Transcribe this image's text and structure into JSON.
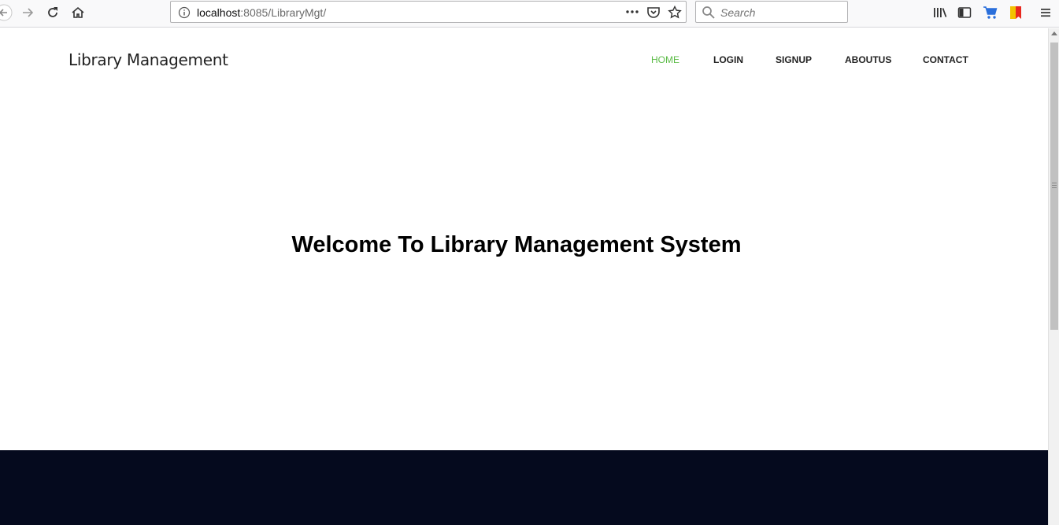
{
  "browser": {
    "url_host": "localhost",
    "url_rest": ":8085/LibraryMgt/",
    "search_placeholder": "Search"
  },
  "site": {
    "brand": "Library Management",
    "nav": [
      {
        "label": "HOME",
        "active": true
      },
      {
        "label": "LOGIN",
        "active": false
      },
      {
        "label": "SIGNUP",
        "active": false
      },
      {
        "label": "ABOUTUS",
        "active": false
      },
      {
        "label": "CONTACT",
        "active": false
      }
    ],
    "welcome": "Welcome To Library Management System"
  },
  "colors": {
    "nav_active": "#5bbb46",
    "footer_bg": "#050a1e"
  },
  "icons": [
    "back-icon",
    "forward-icon",
    "reload-icon",
    "home-icon",
    "info-icon",
    "page-actions-icon",
    "pocket-icon",
    "bookmark-star-icon",
    "search-icon",
    "library-icon",
    "sidebar-icon",
    "cart-icon",
    "flag-icon",
    "menu-icon"
  ]
}
